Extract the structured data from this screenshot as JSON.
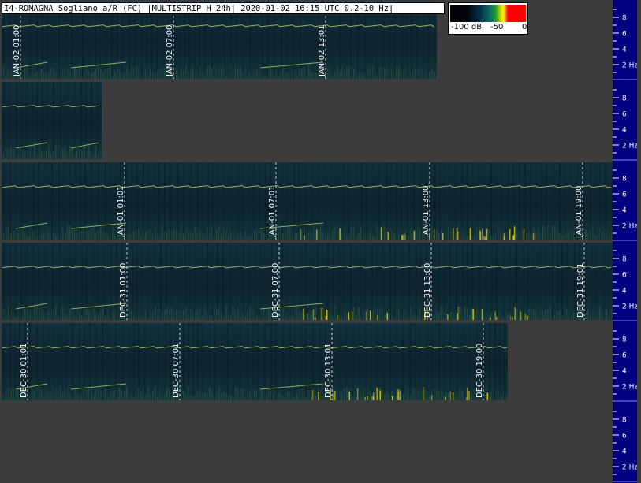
{
  "title": "I4-ROMAGNA Sogliano a/R (FC) |MULTISTRIP H 24h| 2020-01-02 16:15 UTC 0.2-10 Hz|",
  "colorbar": {
    "ticks": [
      "-100 dB",
      "-50",
      "0"
    ]
  },
  "chart_data": {
    "type": "heatmap",
    "axis_labels": [
      "8",
      "6",
      "4",
      "2 Hz"
    ],
    "freq_range_hz": [
      0.2,
      10
    ],
    "colors": {
      "background": "#3c3c3c",
      "axis_bar": "#000080",
      "spectrogram_base": "#0b1f2a",
      "signal_line": "#c8e07a",
      "hot": "#ffe000"
    },
    "strips": [
      {
        "time_labels": [
          "JAN-02 01:00",
          "JAN-02 07:00",
          "JAN-02 13:01"
        ],
        "tick_hours": [
          1,
          7,
          13
        ]
      },
      {
        "time_labels": [],
        "tick_hours": []
      },
      {
        "time_labels": [
          "JAN-01 01:01",
          "JAN-01 07:01",
          "JAN-01 13:00",
          "JAN-01 19:00"
        ],
        "tick_hours": [
          1,
          7,
          13,
          19
        ]
      },
      {
        "time_labels": [
          "DEC-31 01:00",
          "DEC-31 07:00",
          "DEC-31 13:00",
          "DEC-31 19:01"
        ],
        "tick_hours": [
          1,
          7,
          13,
          19
        ]
      },
      {
        "time_labels": [
          "DEC-30 01:01",
          "DEC-30 07:01",
          "DEC-30 13:01",
          "DEC-30 19:00"
        ],
        "tick_hours": [
          1,
          7,
          13,
          19
        ]
      }
    ]
  }
}
